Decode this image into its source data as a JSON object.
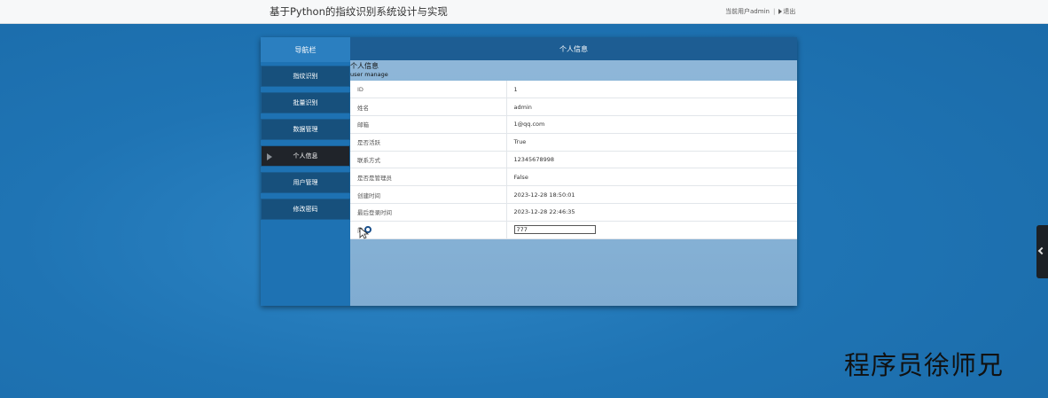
{
  "header": {
    "title": "基于Python的指纹识别系统设计与实现",
    "user_text": "当前用户admin",
    "logout_label": "退出"
  },
  "sidebar": {
    "heading": "导航栏",
    "items": [
      {
        "label": "指纹识别"
      },
      {
        "label": "批量识别"
      },
      {
        "label": "数据管理"
      },
      {
        "label": "个人信息",
        "active": true
      },
      {
        "label": "用户管理"
      },
      {
        "label": "修改密码"
      }
    ]
  },
  "content": {
    "heading": "个人信息",
    "section_title": "个人信息",
    "section_subtitle": "user manage",
    "rows": [
      {
        "label": "ID",
        "value": "1"
      },
      {
        "label": "姓名",
        "value": "admin"
      },
      {
        "label": "邮箱",
        "value": "1@qq.com"
      },
      {
        "label": "是否活跃",
        "value": "True"
      },
      {
        "label": "联系方式",
        "value": "12345678998"
      },
      {
        "label": "是否是管理员",
        "value": "False"
      },
      {
        "label": "创建时间",
        "value": "2023-12-28 18:50:01"
      },
      {
        "label": "最后登录时间",
        "value": "2023-12-28 22:46:35"
      }
    ],
    "input_row": {
      "label": "简介",
      "value": "777"
    }
  },
  "watermark": "程序员徐师兄",
  "icons": {
    "cursor": "mouse-pointer-icon",
    "side_arrow": "play-arrow-icon",
    "edge": "chevron-left-icon",
    "logout": "logout-icon"
  }
}
